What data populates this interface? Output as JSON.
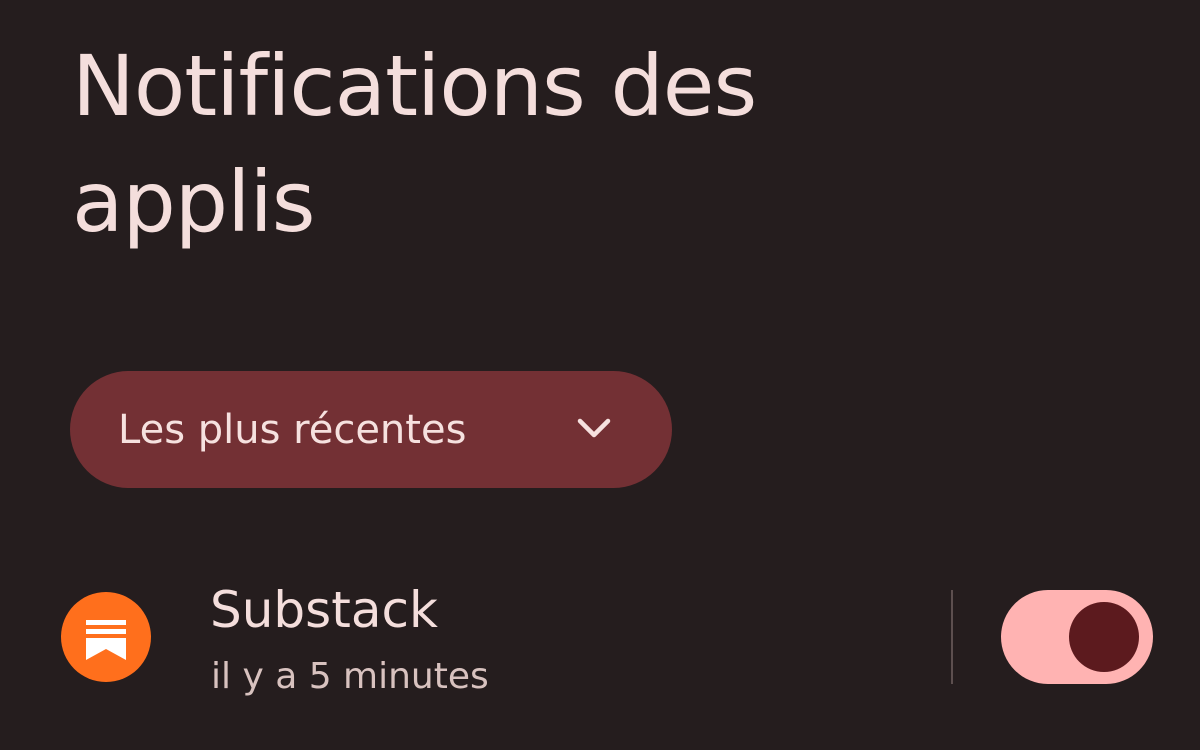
{
  "page": {
    "title": "Notifications des applis"
  },
  "filter": {
    "selected_label": "Les plus récentes",
    "icon": "chevron-down-icon"
  },
  "apps": [
    {
      "name": "Substack",
      "time": "il y a 5 minutes",
      "icon": "substack-icon",
      "notifications_enabled": true
    }
  ],
  "colors": {
    "background": "#251d1e",
    "chip_background": "#733034",
    "app_icon_background": "#ff6f1c",
    "toggle_track": "#ffb3b2",
    "toggle_knob": "#5c1a1e"
  }
}
